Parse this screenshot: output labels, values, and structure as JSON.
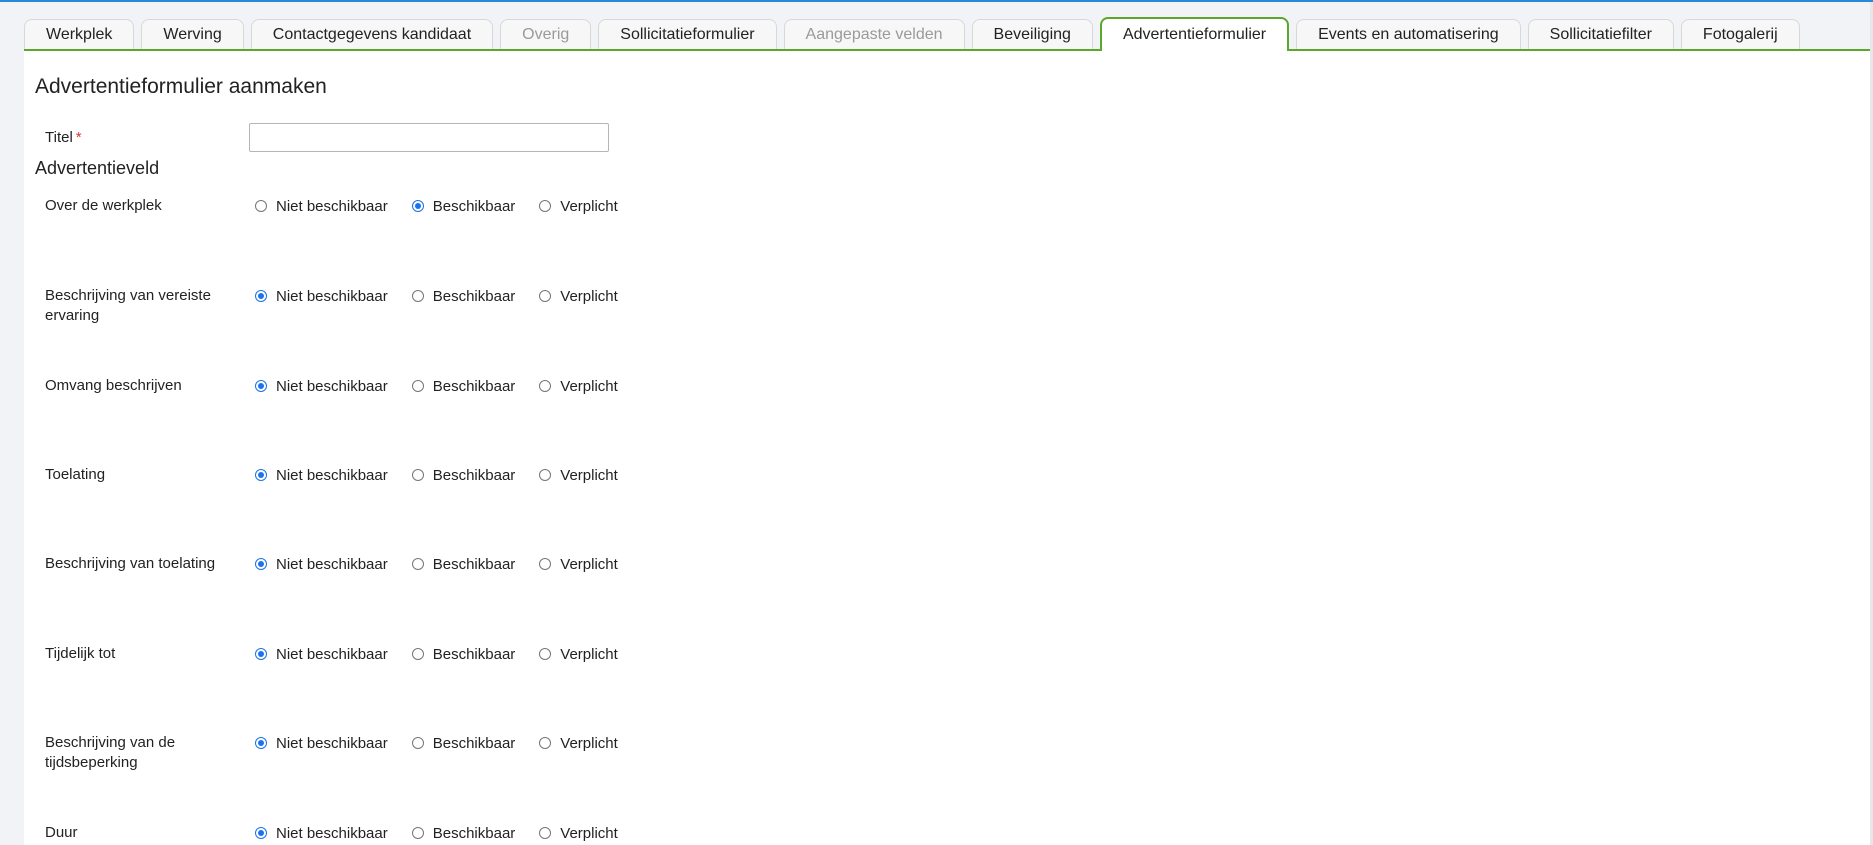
{
  "tabs": [
    {
      "label": "Werkplek",
      "state": "normal"
    },
    {
      "label": "Werving",
      "state": "normal"
    },
    {
      "label": "Contactgegevens kandidaat",
      "state": "normal"
    },
    {
      "label": "Overig",
      "state": "disabled"
    },
    {
      "label": "Sollicitatieformulier",
      "state": "normal"
    },
    {
      "label": "Aangepaste velden",
      "state": "disabled"
    },
    {
      "label": "Beveiliging",
      "state": "normal"
    },
    {
      "label": "Advertentieformulier",
      "state": "active"
    },
    {
      "label": "Events en automatisering",
      "state": "normal"
    },
    {
      "label": "Sollicitatiefilter",
      "state": "normal"
    },
    {
      "label": "Fotogalerij",
      "state": "normal"
    }
  ],
  "form": {
    "title": "Advertentieformulier aanmaken",
    "titel_label": "Titel",
    "required_marker": "*",
    "titel_value": "",
    "section_title": "Advertentieveld",
    "options": [
      "Niet beschikbaar",
      "Beschikbaar",
      "Verplicht"
    ],
    "rows": [
      {
        "label": "Over de werkplek",
        "selected": "Beschikbaar"
      },
      {
        "label": "Beschrijving van vereiste ervaring",
        "selected": "Niet beschikbaar"
      },
      {
        "label": "Omvang beschrijven",
        "selected": "Niet beschikbaar"
      },
      {
        "label": "Toelating",
        "selected": "Niet beschikbaar"
      },
      {
        "label": "Beschrijving van toelating",
        "selected": "Niet beschikbaar"
      },
      {
        "label": "Tijdelijk tot",
        "selected": "Niet beschikbaar"
      },
      {
        "label": "Beschrijving van de tijdsbeperking",
        "selected": "Niet beschikbaar"
      },
      {
        "label": "Duur",
        "selected": "Niet beschikbaar"
      }
    ]
  },
  "colors": {
    "accent": "#5aa82a",
    "radio": "#1a73e8",
    "required": "#dd3333"
  }
}
